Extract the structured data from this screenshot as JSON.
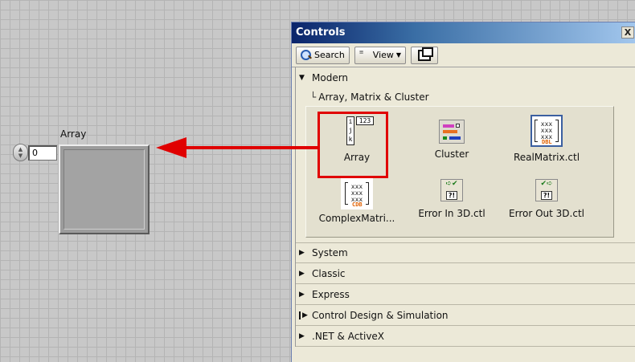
{
  "front_panel": {
    "array_label": "Array",
    "index_value": "0"
  },
  "palette": {
    "title": "Controls",
    "close_glyph": "X",
    "toolbar": {
      "search_label": "Search",
      "view_label": "View"
    },
    "open_category": "Modern",
    "open_subcategory": "Array, Matrix & Cluster",
    "icons": [
      {
        "label": "Array",
        "icon": "array-icon"
      },
      {
        "label": "Cluster",
        "icon": "cluster-icon"
      },
      {
        "label": "RealMatrix.ctl",
        "icon": "real-matrix-icon"
      },
      {
        "label": "ComplexMatri...",
        "icon": "complex-matrix-icon"
      },
      {
        "label": "Error In 3D.ctl",
        "icon": "error-in-icon"
      },
      {
        "label": "Error Out 3D.ctl",
        "icon": "error-out-icon"
      }
    ],
    "array_icon_text": {
      "index": "i j k",
      "value": "123"
    },
    "matrix_tags": {
      "real": "DBL",
      "complex": "CDB"
    },
    "error_glyph": "?!",
    "categories": [
      {
        "label": "System"
      },
      {
        "label": "Classic"
      },
      {
        "label": "Express"
      },
      {
        "label": "Control Design & Simulation"
      },
      {
        "label": ".NET & ActiveX"
      }
    ]
  },
  "annotation": {
    "highlight_color": "#e00000",
    "arrow_color": "#e00000"
  }
}
